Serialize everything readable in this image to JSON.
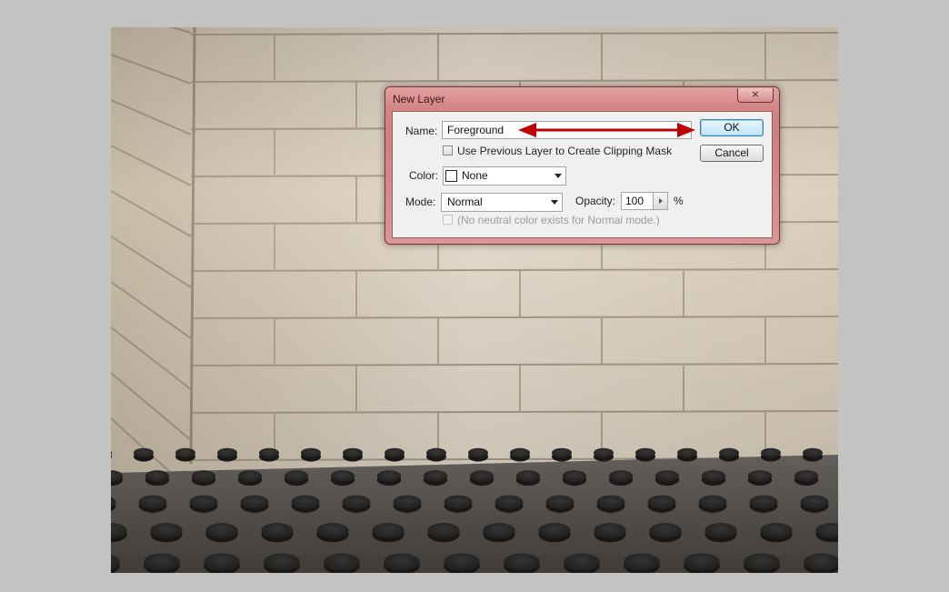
{
  "dialog": {
    "title": "New Layer",
    "close_label": "⨯",
    "name_label": "Name:",
    "name_value": "Foreground",
    "clipping_label": "Use Previous Layer to Create Clipping Mask",
    "clipping_checked": false,
    "color_label": "Color:",
    "color_value": "None",
    "mode_label": "Mode:",
    "mode_value": "Normal",
    "opacity_label": "Opacity:",
    "opacity_value": "100",
    "opacity_unit": "%",
    "neutral_label": "(No neutral color exists for Normal mode.)",
    "neutral_enabled": false,
    "ok_label": "OK",
    "cancel_label": "Cancel"
  },
  "annotation": {
    "arrow_color": "#c00000"
  },
  "colors": {
    "background": "#c3c3c3",
    "dialog_frame": "#d58786",
    "ok_button": "#bfe4f9"
  }
}
